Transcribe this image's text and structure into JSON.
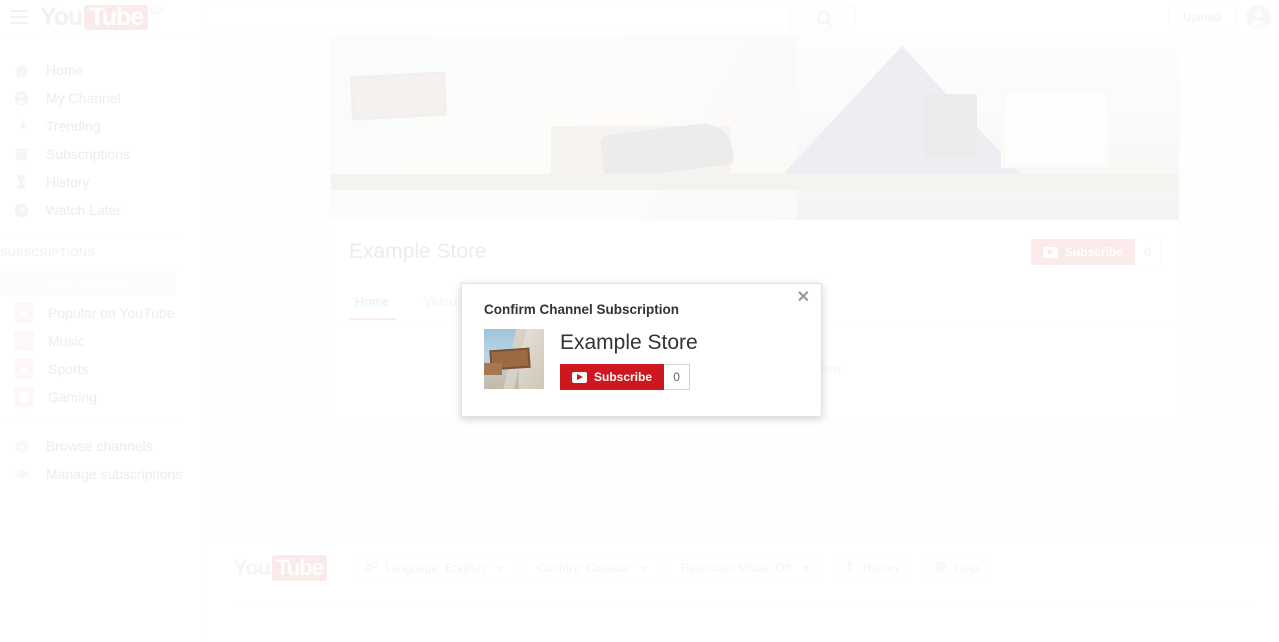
{
  "header": {
    "menu_icon": "hamburger-icon",
    "logo_you": "You",
    "logo_tube": "Tube",
    "logo_country": "CA",
    "search_value": "",
    "search_placeholder": "",
    "search_icon": "search-icon",
    "upload_label": "Upload",
    "avatar_icon": "account-avatar-icon"
  },
  "sidebar": {
    "nav": [
      {
        "label": "Home",
        "icon": "home-icon"
      },
      {
        "label": "My Channel",
        "icon": "account-circle-icon"
      },
      {
        "label": "Trending",
        "icon": "flame-icon"
      },
      {
        "label": "Subscriptions",
        "icon": "inbox-icon"
      },
      {
        "label": "History",
        "icon": "hourglass-icon"
      },
      {
        "label": "Watch Later",
        "icon": "clock-icon"
      }
    ],
    "subscriptions_heading": "SUBSCRIPTIONS",
    "add_channels_label": "Add channels",
    "channels": [
      {
        "label": "Popular on YouTube",
        "icon": "popular-thumb-icon"
      },
      {
        "label": "Music",
        "icon": "headphones-thumb-icon"
      },
      {
        "label": "Sports",
        "icon": "trophy-thumb-icon"
      },
      {
        "label": "Gaming",
        "icon": "gamepad-thumb-icon"
      }
    ],
    "lower": [
      {
        "label": "Browse channels",
        "icon": "plus-circle-icon"
      },
      {
        "label": "Manage subscriptions",
        "icon": "gear-icon"
      }
    ]
  },
  "channel": {
    "banner_alt": "store-interior-banner",
    "title": "Example Store",
    "subscribe_label": "Subscribe",
    "subscribe_count": "0",
    "tabs": [
      {
        "label": "Home",
        "active": true
      },
      {
        "label": "Videos",
        "active": false
      }
    ],
    "empty_message": "This channel has no content."
  },
  "footer": {
    "logo_you": "You",
    "logo_tube": "Tube",
    "buttons": [
      {
        "label": "Language: English",
        "icon": "language-icon",
        "caret": true
      },
      {
        "label": "Country: Canada",
        "icon": "",
        "caret": true
      },
      {
        "label": "Restricted Mode: Off",
        "icon": "",
        "caret": true
      },
      {
        "label": "History",
        "icon": "hourglass-icon",
        "caret": false
      },
      {
        "label": "Help",
        "icon": "help-circle-icon",
        "caret": false
      }
    ]
  },
  "modal": {
    "title": "Confirm Channel Subscription",
    "close_icon": "close-icon",
    "thumbnail_alt": "channel-thumbnail-woods-sign",
    "channel_name": "Example Store",
    "subscribe_label": "Subscribe",
    "subscribe_count": "0"
  },
  "colors": {
    "brand_red": "#cc181e",
    "add_channels_bg": "#cfe4f5",
    "text_primary": "#333333",
    "text_muted": "#999999"
  }
}
